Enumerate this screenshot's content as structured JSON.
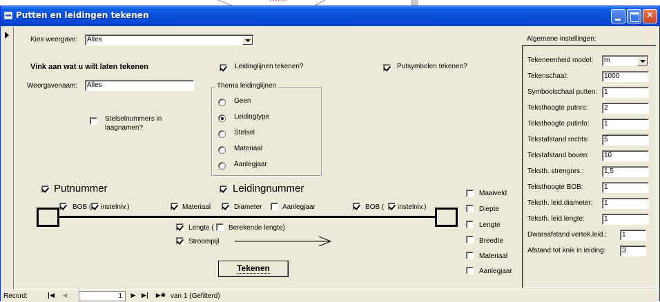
{
  "window": {
    "title": "Putten en leidingen tekenen"
  },
  "view": {
    "label": "Kies weergave:",
    "value": "Alles"
  },
  "section": {
    "draw_heading": "Vink aan wat u wilt laten tekenen"
  },
  "display_name": {
    "label": "Weergavenaam:",
    "value": "Alles"
  },
  "options": {
    "system_numbers": {
      "label_line1": "Stelselnummers in",
      "label_line2": "laagnamen?",
      "checked": false
    },
    "draw_pipelines": {
      "label": "Leidinglijnen tekenen?",
      "checked": true
    },
    "draw_pit_symbols": {
      "label": "Putsymbolen tekenen?",
      "checked": true
    }
  },
  "theme": {
    "title": "Thema leidinglijnen",
    "options": [
      "Geen",
      "Leidingtype",
      "Stelsel",
      "Materiaal",
      "Aanlegjaar"
    ],
    "selected": "Leidingtype"
  },
  "diagram": {
    "pit_number": {
      "label": "Putnummer",
      "checked": true
    },
    "pipe_number": {
      "label": "Leidingnummer",
      "checked": true
    },
    "bob_left": {
      "label": "BOB (",
      "checked": true
    },
    "insteln_left": {
      "label": "instelniv.)",
      "checked": true
    },
    "material": {
      "label": "Materiaal",
      "checked": true
    },
    "diameter": {
      "label": "Diameter",
      "checked": true
    },
    "laying_year": {
      "label": "Aanlegjaar",
      "checked": false
    },
    "bob_right": {
      "label": "BOB (",
      "checked": true
    },
    "insteln_right": {
      "label": "instelniv.)",
      "checked": true
    },
    "length": {
      "label": "Lengte (",
      "checked": true
    },
    "computed_length": {
      "label": "Berekende lengte)",
      "checked": false
    },
    "flow_arrow": {
      "label": "Stroompijl",
      "checked": true
    }
  },
  "pit_attributes": [
    {
      "label": "Maaiveld",
      "checked": false
    },
    {
      "label": "Diepte",
      "checked": false
    },
    {
      "label": "Lengte",
      "checked": false
    },
    {
      "label": "Breedte",
      "checked": false
    },
    {
      "label": "Materiaal",
      "checked": false
    },
    {
      "label": "Aanlegjaar",
      "checked": false
    }
  ],
  "draw_button": {
    "label": "Tekenen"
  },
  "settings": {
    "title": "Algemene instellingen:",
    "rows": [
      {
        "label": "Tekeneenheid model:",
        "value": "m"
      },
      {
        "label": "Tekenschaal:",
        "value": "1000"
      },
      {
        "label": "Symboolschaal putten:",
        "value": "1"
      },
      {
        "label": "Teksthoogte putnrs:",
        "value": "2"
      },
      {
        "label": "Teksthoogte putinfo:",
        "value": "1"
      },
      {
        "label": "Tekstafstand rechts:",
        "value": "5"
      },
      {
        "label": "Tekstafstand boven:",
        "value": "10"
      },
      {
        "label": "Teksth. strengnrs.:",
        "value": "1,5"
      },
      {
        "label": "Teksthoogte BOB:",
        "value": "1"
      },
      {
        "label": "Teksth. leid.diameter:",
        "value": "1"
      },
      {
        "label": "Teksth. leid.lengte:",
        "value": "1"
      },
      {
        "label": "Dwarsafstand vertek.leid.:",
        "value": "1"
      },
      {
        "label": "Afstand tot knik in leiding:",
        "value": "3"
      }
    ]
  },
  "navigation": {
    "record_label": "Record:",
    "current": "1",
    "total_text": "van 1 (Gefilterd)"
  }
}
